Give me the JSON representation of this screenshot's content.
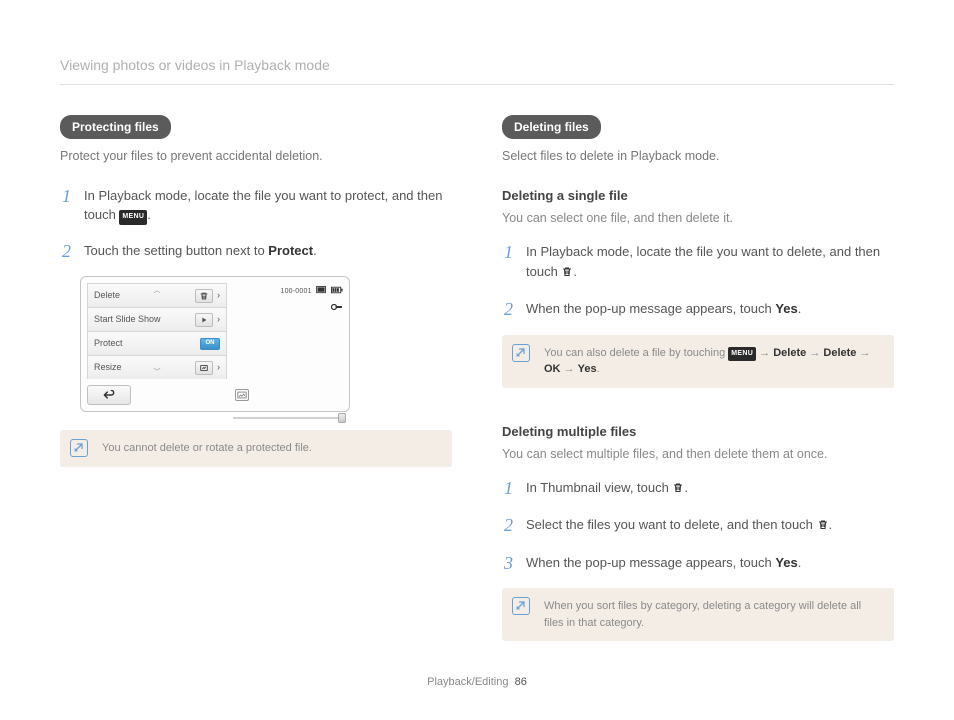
{
  "header": {
    "title": "Viewing photos or videos in Playback mode"
  },
  "left": {
    "pill": "Protecting files",
    "intro": "Protect your files to prevent accidental deletion.",
    "steps": [
      {
        "pre": "In Playback mode, locate the file you want to protect, and then touch ",
        "mid": "",
        "post": "."
      },
      {
        "pre": "Touch the setting button next to ",
        "bold": "Protect",
        "post": "."
      }
    ],
    "device": {
      "rows": {
        "delete": "Delete",
        "slide": "Start Slide Show",
        "protect": "Protect",
        "resize": "Resize"
      },
      "on": "ON",
      "counter": "100-0001"
    },
    "note": "You cannot delete or rotate a protected file."
  },
  "right": {
    "pill": "Deleting files",
    "intro": "Select files to delete in Playback mode.",
    "single": {
      "head": "Deleting a single file",
      "intro": "You can select one file, and then delete it.",
      "steps": [
        {
          "pre": "In Playback mode, locate the file you want to delete, and then touch ",
          "post": "."
        },
        {
          "pre": "When the pop-up message appears, touch ",
          "bold": "Yes",
          "post": "."
        }
      ],
      "note_pre": "You can also delete a file by touching ",
      "note_seq": {
        "a": "Delete",
        "b": "Delete",
        "c": "OK",
        "d": "Yes"
      },
      "arrow": "→"
    },
    "multi": {
      "head": "Deleting multiple files",
      "intro": "You can select multiple files, and then delete them at once.",
      "steps": [
        {
          "pre": "In Thumbnail view, touch ",
          "post": "."
        },
        {
          "pre": "Select the files you want to delete, and then touch ",
          "post": "."
        },
        {
          "pre": "When the pop-up message appears, touch ",
          "bold": "Yes",
          "post": "."
        }
      ],
      "note": "When you sort files by category, deleting a category will delete all files in that category."
    }
  },
  "footer": {
    "section": "Playback/Editing",
    "page": "86"
  },
  "icons": {
    "menu": "MENU"
  }
}
